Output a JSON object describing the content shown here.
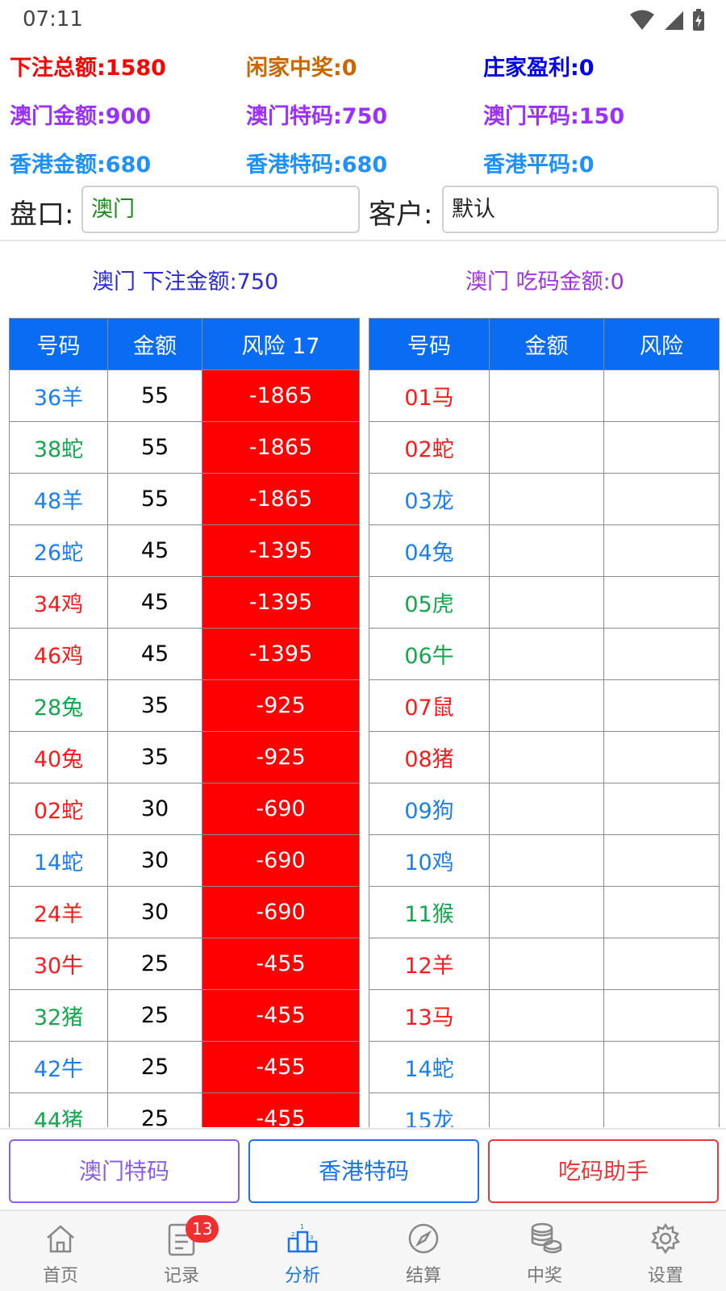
{
  "status_bar": {
    "time": "07:11"
  },
  "stats": {
    "row1": [
      {
        "text": "下注总额:1580",
        "color": "#ff0000"
      },
      {
        "text": "闲家中奖:0",
        "color": "#cc6600"
      },
      {
        "text": "庄家盈利:0",
        "color": "#0000ee"
      }
    ],
    "row2": [
      {
        "text": "澳门金额:900",
        "color": "#9b30ff"
      },
      {
        "text": "澳门特码:750",
        "color": "#9b30ff"
      },
      {
        "text": "澳门平码:150",
        "color": "#9b30ff"
      }
    ],
    "row3": [
      {
        "text": "香港金额:680",
        "color": "#1e90ff"
      },
      {
        "text": "香港特码:680",
        "color": "#1e90ff"
      },
      {
        "text": "香港平码:0",
        "color": "#1e90ff"
      }
    ]
  },
  "pankou": {
    "label": "盘口:",
    "value": "澳门",
    "value_color": "#1a8a1a"
  },
  "customer": {
    "label": "客户:",
    "value": "默认"
  },
  "summary": {
    "bet_total": "澳门 下注金额:750",
    "bet_total_color": "#2a2ad6",
    "eat_total": "澳门 吃码金额:0",
    "eat_total_color": "#a033e0"
  },
  "colors": {
    "blue": "#1a7ff0",
    "green": "#13a84e",
    "red": "#ff1a1a",
    "header_bg": "#0a6cf2",
    "risk_bg": "#ff0000"
  },
  "left_table": {
    "headers": [
      "号码",
      "金额",
      "风险 17"
    ],
    "rows": [
      {
        "num": "36羊",
        "color": "blue",
        "amount": "55",
        "risk": "-1865"
      },
      {
        "num": "38蛇",
        "color": "green",
        "amount": "55",
        "risk": "-1865"
      },
      {
        "num": "48羊",
        "color": "blue",
        "amount": "55",
        "risk": "-1865"
      },
      {
        "num": "26蛇",
        "color": "blue",
        "amount": "45",
        "risk": "-1395"
      },
      {
        "num": "34鸡",
        "color": "red",
        "amount": "45",
        "risk": "-1395"
      },
      {
        "num": "46鸡",
        "color": "red",
        "amount": "45",
        "risk": "-1395"
      },
      {
        "num": "28兔",
        "color": "green",
        "amount": "35",
        "risk": "-925"
      },
      {
        "num": "40兔",
        "color": "red",
        "amount": "35",
        "risk": "-925"
      },
      {
        "num": "02蛇",
        "color": "red",
        "amount": "30",
        "risk": "-690"
      },
      {
        "num": "14蛇",
        "color": "blue",
        "amount": "30",
        "risk": "-690"
      },
      {
        "num": "24羊",
        "color": "red",
        "amount": "30",
        "risk": "-690"
      },
      {
        "num": "30牛",
        "color": "red",
        "amount": "25",
        "risk": "-455"
      },
      {
        "num": "32猪",
        "color": "green",
        "amount": "25",
        "risk": "-455"
      },
      {
        "num": "42牛",
        "color": "blue",
        "amount": "25",
        "risk": "-455"
      },
      {
        "num": "44猪",
        "color": "green",
        "amount": "25",
        "risk": "-455"
      }
    ]
  },
  "right_table": {
    "headers": [
      "号码",
      "金额",
      "风险"
    ],
    "rows": [
      {
        "num": "01马",
        "color": "red",
        "amount": "",
        "risk": ""
      },
      {
        "num": "02蛇",
        "color": "red",
        "amount": "",
        "risk": ""
      },
      {
        "num": "03龙",
        "color": "blue",
        "amount": "",
        "risk": ""
      },
      {
        "num": "04兔",
        "color": "blue",
        "amount": "",
        "risk": ""
      },
      {
        "num": "05虎",
        "color": "green",
        "amount": "",
        "risk": ""
      },
      {
        "num": "06牛",
        "color": "green",
        "amount": "",
        "risk": ""
      },
      {
        "num": "07鼠",
        "color": "red",
        "amount": "",
        "risk": ""
      },
      {
        "num": "08猪",
        "color": "red",
        "amount": "",
        "risk": ""
      },
      {
        "num": "09狗",
        "color": "blue",
        "amount": "",
        "risk": ""
      },
      {
        "num": "10鸡",
        "color": "blue",
        "amount": "",
        "risk": ""
      },
      {
        "num": "11猴",
        "color": "green",
        "amount": "",
        "risk": ""
      },
      {
        "num": "12羊",
        "color": "red",
        "amount": "",
        "risk": ""
      },
      {
        "num": "13马",
        "color": "red",
        "amount": "",
        "risk": ""
      },
      {
        "num": "14蛇",
        "color": "blue",
        "amount": "",
        "risk": ""
      },
      {
        "num": "15龙",
        "color": "blue",
        "amount": "",
        "risk": ""
      }
    ]
  },
  "buttons": {
    "macau_special": {
      "label": "澳门特码",
      "color": "#8a5cf0"
    },
    "hk_special": {
      "label": "香港特码",
      "color": "#1a73e8"
    },
    "eat_helper": {
      "label": "吃码助手",
      "color": "#e83a3a"
    }
  },
  "nav": {
    "items": [
      {
        "label": "首页",
        "icon": "home-icon",
        "active": false
      },
      {
        "label": "记录",
        "icon": "record-icon",
        "active": false,
        "badge": "13"
      },
      {
        "label": "分析",
        "icon": "podium-icon",
        "active": true
      },
      {
        "label": "结算",
        "icon": "compass-icon",
        "active": false
      },
      {
        "label": "中奖",
        "icon": "coins-icon",
        "active": false
      },
      {
        "label": "设置",
        "icon": "gear-icon",
        "active": false
      }
    ]
  }
}
